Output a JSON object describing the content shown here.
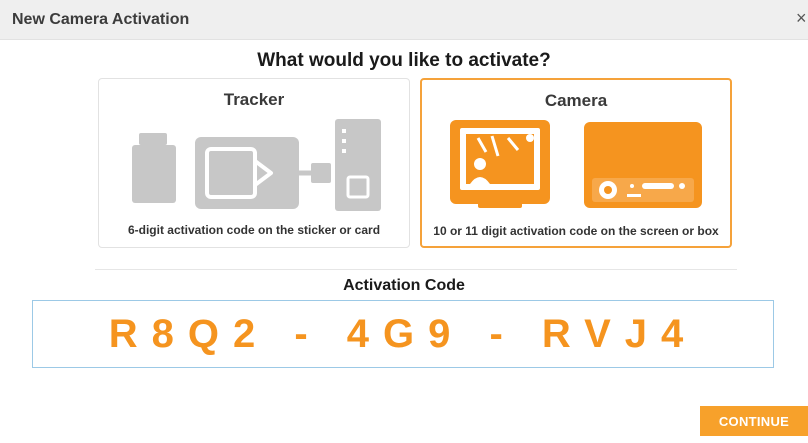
{
  "dialog": {
    "title": "New Camera Activation",
    "close_symbol": "×"
  },
  "question": "What would you like to activate?",
  "options": [
    {
      "title": "Tracker",
      "description": "6-digit activation code on the sticker or card",
      "icon": "tracker-devices-icon",
      "selected": false
    },
    {
      "title": "Camera",
      "description": "10 or 11 digit activation code on the screen or box",
      "icon": "camera-devices-icon",
      "selected": true
    }
  ],
  "activation": {
    "label": "Activation Code",
    "value": "R8Q2 - 4G9 - RVJ4"
  },
  "continue_label": "CONTINUE",
  "colors": {
    "accent": "#f5941f",
    "selected_border": "#f5a23a",
    "input_border": "#9cc9e6",
    "icon_grey": "#c7c7c7"
  }
}
